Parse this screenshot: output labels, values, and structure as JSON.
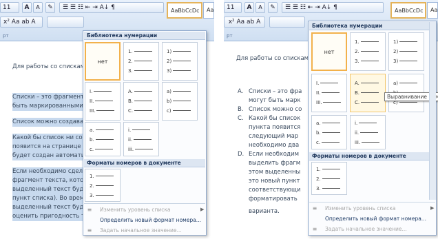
{
  "left": {
    "toolbar": {
      "font_size": "11",
      "font_grow": "A",
      "font_shrink": "A",
      "clear_fmt": "✎",
      "row2": "x² Aa ab A",
      "para_buttons": "☰ ☰ ☷ ⇤ ⇥ A↓ ¶",
      "style_sample": "AaBbCcDc",
      "style_sample2": "Aal",
      "group_label": "рт"
    },
    "intro": "Для работы со списками",
    "paras": [
      "Списки – это фрагменты",
      "быть маркированными,",
      "Список можно создавать",
      "Какой бы список ни созд",
      "появится на странице до",
      "будет создан автоматич",
      "Если необходимо сделат",
      "фрагмент текста, которы",
      "выделенный текст буде",
      "пункт списка). Во время",
      "выделенный текст буде",
      "оценить пригодность то"
    ],
    "menu": {
      "library_header": "Библиотека нумерации",
      "none_label": "нет",
      "fmt_arabic": [
        "1.",
        "2.",
        "3."
      ],
      "fmt_paren": [
        "1)",
        "2)",
        "3)"
      ],
      "fmt_roman": [
        "I.",
        "II.",
        "III."
      ],
      "fmt_alpha_upper": [
        "A.",
        "B.",
        "C."
      ],
      "fmt_alpha_paren": [
        "a)",
        "b)",
        "c)"
      ],
      "fmt_alpha_lower": [
        "a.",
        "b.",
        "c."
      ],
      "fmt_roman_lower": [
        "i.",
        "ii.",
        "iii."
      ],
      "doc_header": "Форматы номеров в документе",
      "doc_fmt": [
        "1.",
        "2.",
        "3."
      ],
      "change_level": "Изменить уровень списка",
      "define_new": "Определить новый формат номера...",
      "set_start": "Задать начальное значение..."
    }
  },
  "right": {
    "toolbar": {
      "font_size": "11",
      "style_sample": "AaBbCcDc",
      "style_sample2": "Aa",
      "group_label": "рт"
    },
    "intro": "Для работы со списками",
    "items": [
      {
        "n": "A.",
        "t": "Списки – это фра"
      },
      {
        "n": "",
        "t": "могут быть марк"
      },
      {
        "n": "B.",
        "t": "Список можно со"
      },
      {
        "n": "C.",
        "t": "Какой бы список"
      },
      {
        "n": "",
        "t": "пункта появится"
      },
      {
        "n": "",
        "t": "следующий мар"
      },
      {
        "n": "",
        "t": "необходимо два"
      },
      {
        "n": "D.",
        "t": "Если необходим"
      },
      {
        "n": "",
        "t": "выделить фрагм"
      },
      {
        "n": "",
        "t": "этом выделенны"
      },
      {
        "n": "",
        "t": "это новый пункт"
      },
      {
        "n": "",
        "t": "соответствующи"
      },
      {
        "n": "",
        "t": "форматировать"
      },
      {
        "n": "",
        "t": "варианта."
      }
    ],
    "tooltip": "Выравнивание номера: По",
    "menu": {
      "library_header": "Библиотека нумерации",
      "none_label": "нет",
      "fmt_arabic": [
        "1.",
        "2.",
        "3."
      ],
      "fmt_paren": [
        "1)",
        "2)",
        "3)"
      ],
      "fmt_roman": [
        "I.",
        "II.",
        "III."
      ],
      "fmt_alpha_upper": [
        "A.",
        "B.",
        "C."
      ],
      "fmt_alpha_paren": [
        "a)",
        "b)",
        "c)"
      ],
      "fmt_alpha_lower": [
        "a.",
        "b.",
        "c."
      ],
      "fmt_roman_lower": [
        "i.",
        "ii.",
        "iii."
      ],
      "doc_header": "Форматы номеров в документе",
      "doc_fmt": [
        "1.",
        "2.",
        "3."
      ],
      "change_level": "Изменить уровень списка",
      "define_new": "Определить новый формат номера...",
      "set_start": "Задать начальное значение..."
    }
  }
}
